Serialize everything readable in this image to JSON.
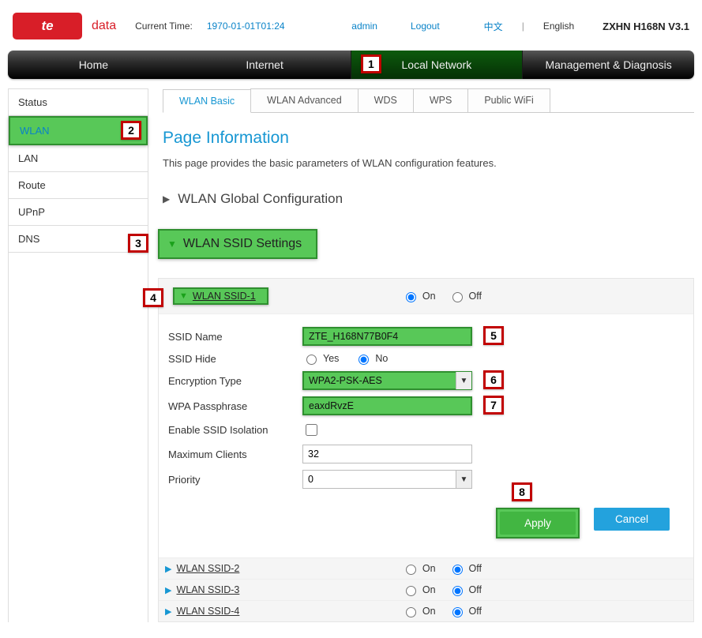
{
  "header": {
    "logo_main": "te",
    "logo_side": "data",
    "current_time_label": "Current Time:",
    "current_time_value": "1970-01-01T01:24",
    "user": "admin",
    "logout": "Logout",
    "lang_cn": "中文",
    "lang_en": "English",
    "model": "ZXHN H168N V3.1"
  },
  "nav": {
    "home": "Home",
    "internet": "Internet",
    "local_network": "Local Network",
    "management": "Management & Diagnosis"
  },
  "sidebar": {
    "status": "Status",
    "wlan": "WLAN",
    "lan": "LAN",
    "route": "Route",
    "upnp": "UPnP",
    "dns": "DNS"
  },
  "tabs": {
    "wlan_basic": "WLAN Basic",
    "wlan_advanced": "WLAN Advanced",
    "wds": "WDS",
    "wps": "WPS",
    "public_wifi": "Public WiFi"
  },
  "page_title": "Page Information",
  "page_desc": "This page provides the basic parameters of WLAN configuration features.",
  "sections": {
    "global": "WLAN Global Configuration",
    "ssid_settings": "WLAN SSID Settings"
  },
  "ssid1": {
    "title": "WLAN SSID-1",
    "on": "On",
    "off": "Off",
    "fields": {
      "ssid_name_label": "SSID Name",
      "ssid_name_value": "ZTE_H168N77B0F4",
      "ssid_hide_label": "SSID Hide",
      "yes": "Yes",
      "no": "No",
      "enc_label": "Encryption Type",
      "enc_value": "WPA2-PSK-AES",
      "wpa_label": "WPA Passphrase",
      "wpa_value": "eaxdRvzE",
      "isolation_label": "Enable SSID Isolation",
      "max_clients_label": "Maximum Clients",
      "max_clients_value": "32",
      "priority_label": "Priority",
      "priority_value": "0"
    },
    "apply": "Apply",
    "cancel": "Cancel"
  },
  "other_ssids": [
    {
      "title": "WLAN SSID-2",
      "on": "On",
      "off": "Off"
    },
    {
      "title": "WLAN SSID-3",
      "on": "On",
      "off": "Off"
    },
    {
      "title": "WLAN SSID-4",
      "on": "On",
      "off": "Off"
    }
  ],
  "markers": {
    "m1": "1",
    "m2": "2",
    "m3": "3",
    "m4": "4",
    "m5": "5",
    "m6": "6",
    "m7": "7",
    "m8": "8"
  }
}
